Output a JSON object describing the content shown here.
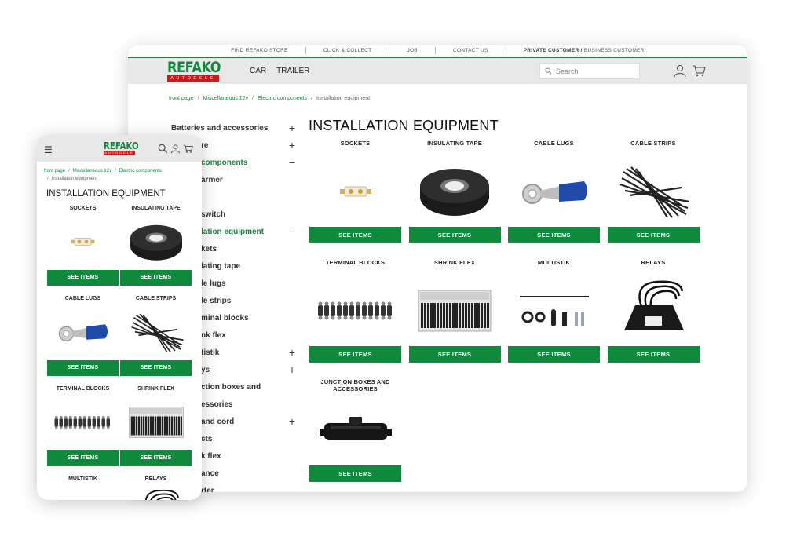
{
  "topbar": {
    "find_store": "FIND REFAKO STORE",
    "click_collect": "CLICK & COLLECT",
    "job": "JOB",
    "contact": "CONTACT US",
    "private": "PRIVATE CUSTOMER /",
    "business": " BUSINESS CUSTOMER"
  },
  "brand": {
    "name": "REFAKO",
    "sub": "AUTODELE",
    "green": "#0f8a3d",
    "red": "#d01818"
  },
  "nav": {
    "car": "CAR",
    "trailer": "TRAILER"
  },
  "search": {
    "placeholder": "Search"
  },
  "breadcrumb": {
    "home": "front page",
    "misc": "Miscellaneous 12v",
    "electric": "Electric components",
    "current": "Installation equipment"
  },
  "sidebar": {
    "items": [
      {
        "label": "Batteries and accessories",
        "toggle": "+"
      },
      {
        "label": "re",
        "toggle": "+"
      },
      {
        "label": "components",
        "toggle": "−"
      },
      {
        "label": "armer",
        "toggle": ""
      },
      {
        "label": "",
        "toggle": ""
      },
      {
        "label": "switch",
        "toggle": ""
      },
      {
        "label": "lation equipment",
        "toggle": "−"
      },
      {
        "label": "kets",
        "toggle": ""
      },
      {
        "label": "lating tape",
        "toggle": ""
      },
      {
        "label": "le lugs",
        "toggle": ""
      },
      {
        "label": "le strips",
        "toggle": ""
      },
      {
        "label": "minal blocks",
        "toggle": ""
      },
      {
        "label": "nk flex",
        "toggle": ""
      },
      {
        "label": "tistik",
        "toggle": "+"
      },
      {
        "label": "ys",
        "toggle": "+"
      },
      {
        "label": "ction boxes and",
        "toggle": ""
      },
      {
        "label": "essories",
        "toggle": ""
      },
      {
        "label": "and cord",
        "toggle": "+"
      },
      {
        "label": "cts",
        "toggle": ""
      },
      {
        "label": "k flex",
        "toggle": ""
      },
      {
        "label": "ance",
        "toggle": ""
      },
      {
        "label": "rter",
        "toggle": ""
      }
    ]
  },
  "main": {
    "title": "INSTALLATION EQUIPMENT",
    "button_label": "SEE ITEMS",
    "products": [
      {
        "name": "SOCKETS",
        "icon": "socket-image"
      },
      {
        "name": "INSULATING TAPE",
        "icon": "tape-image"
      },
      {
        "name": "CABLE LUGS",
        "icon": "cable-lug-image"
      },
      {
        "name": "CABLE STRIPS",
        "icon": "cable-strips-image"
      },
      {
        "name": "TERMINAL BLOCKS",
        "icon": "terminal-blocks-image"
      },
      {
        "name": "SHRINK FLEX",
        "icon": "shrink-flex-image"
      },
      {
        "name": "MULTISTIK",
        "icon": "multistik-image"
      },
      {
        "name": "RELAYS",
        "icon": "relay-image"
      },
      {
        "name": "JUNCTION BOXES AND ACCESSORIES",
        "icon": "junction-box-image"
      }
    ]
  },
  "mobile": {
    "title": "INSTALLATION EQUIPMENT",
    "crumb_current": "Installation equipment"
  }
}
